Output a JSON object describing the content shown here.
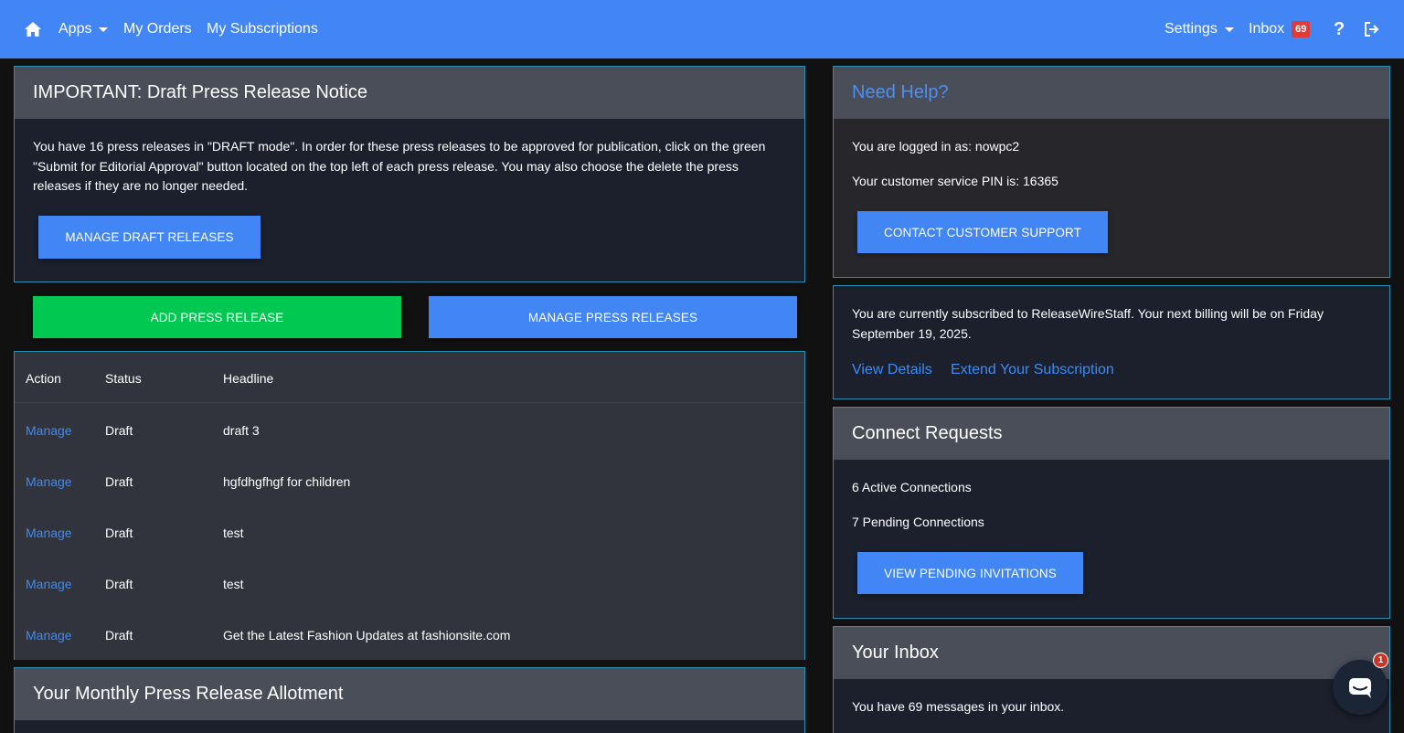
{
  "nav": {
    "apps": "Apps",
    "my_orders": "My Orders",
    "my_subscriptions": "My Subscriptions",
    "settings": "Settings",
    "inbox": "Inbox",
    "inbox_count": "69",
    "help_glyph": "?"
  },
  "draft_notice": {
    "title": "IMPORTANT: Draft Press Release Notice",
    "body": "You have 16 press releases in \"DRAFT mode\". In order for these press releases to be approved for publication, click on the green \"Submit for Editorial Approval\" button located on the top left of each press release. You may also choose the delete the press releases if they are no longer needed.",
    "button": "MANAGE DRAFT RELEASES"
  },
  "actions": {
    "add": "ADD PRESS RELEASE",
    "manage": "MANAGE PRESS RELEASES"
  },
  "table": {
    "headers": [
      "Action",
      "Status",
      "Headline"
    ],
    "rows": [
      {
        "action": "Manage",
        "status": "Draft",
        "headline": "draft 3"
      },
      {
        "action": "Manage",
        "status": "Draft",
        "headline": "hgfdhgfhgf for children"
      },
      {
        "action": "Manage",
        "status": "Draft",
        "headline": "test"
      },
      {
        "action": "Manage",
        "status": "Draft",
        "headline": "test"
      },
      {
        "action": "Manage",
        "status": "Draft",
        "headline": "Get the Latest Fashion Updates at fashionsite.com"
      }
    ]
  },
  "allotment": {
    "title": "Your Monthly Press Release Allotment"
  },
  "help": {
    "title": "Need Help?",
    "logged_in": "You are logged in as: nowpc2",
    "pin": "Your customer service PIN is: 16365",
    "button": "CONTACT CUSTOMER SUPPORT"
  },
  "subscription": {
    "text": "You are currently subscribed to ReleaseWireStaff. Your next billing will be on Friday September 19, 2025.",
    "view_details": "View Details",
    "extend": "Extend Your Subscription"
  },
  "connect": {
    "title": "Connect Requests",
    "active": "6 Active Connections",
    "pending": "7 Pending Connections",
    "button": "VIEW PENDING INVITATIONS"
  },
  "inbox_panel": {
    "title": "Your Inbox",
    "text": "You have 69 messages in your inbox."
  },
  "chat": {
    "badge": "1"
  },
  "colors": {
    "navbar": "#4285f4",
    "primary_button": "#4285f4",
    "success_button": "#00c851",
    "panel_border": "#2b8fb3",
    "panel_header": "#4a4e59",
    "panel_body": "#1b202c",
    "link": "#3d8bf5",
    "badge": "#e53935"
  },
  "icons": [
    "home-icon",
    "question-icon",
    "logout-icon",
    "chat-icon"
  ]
}
